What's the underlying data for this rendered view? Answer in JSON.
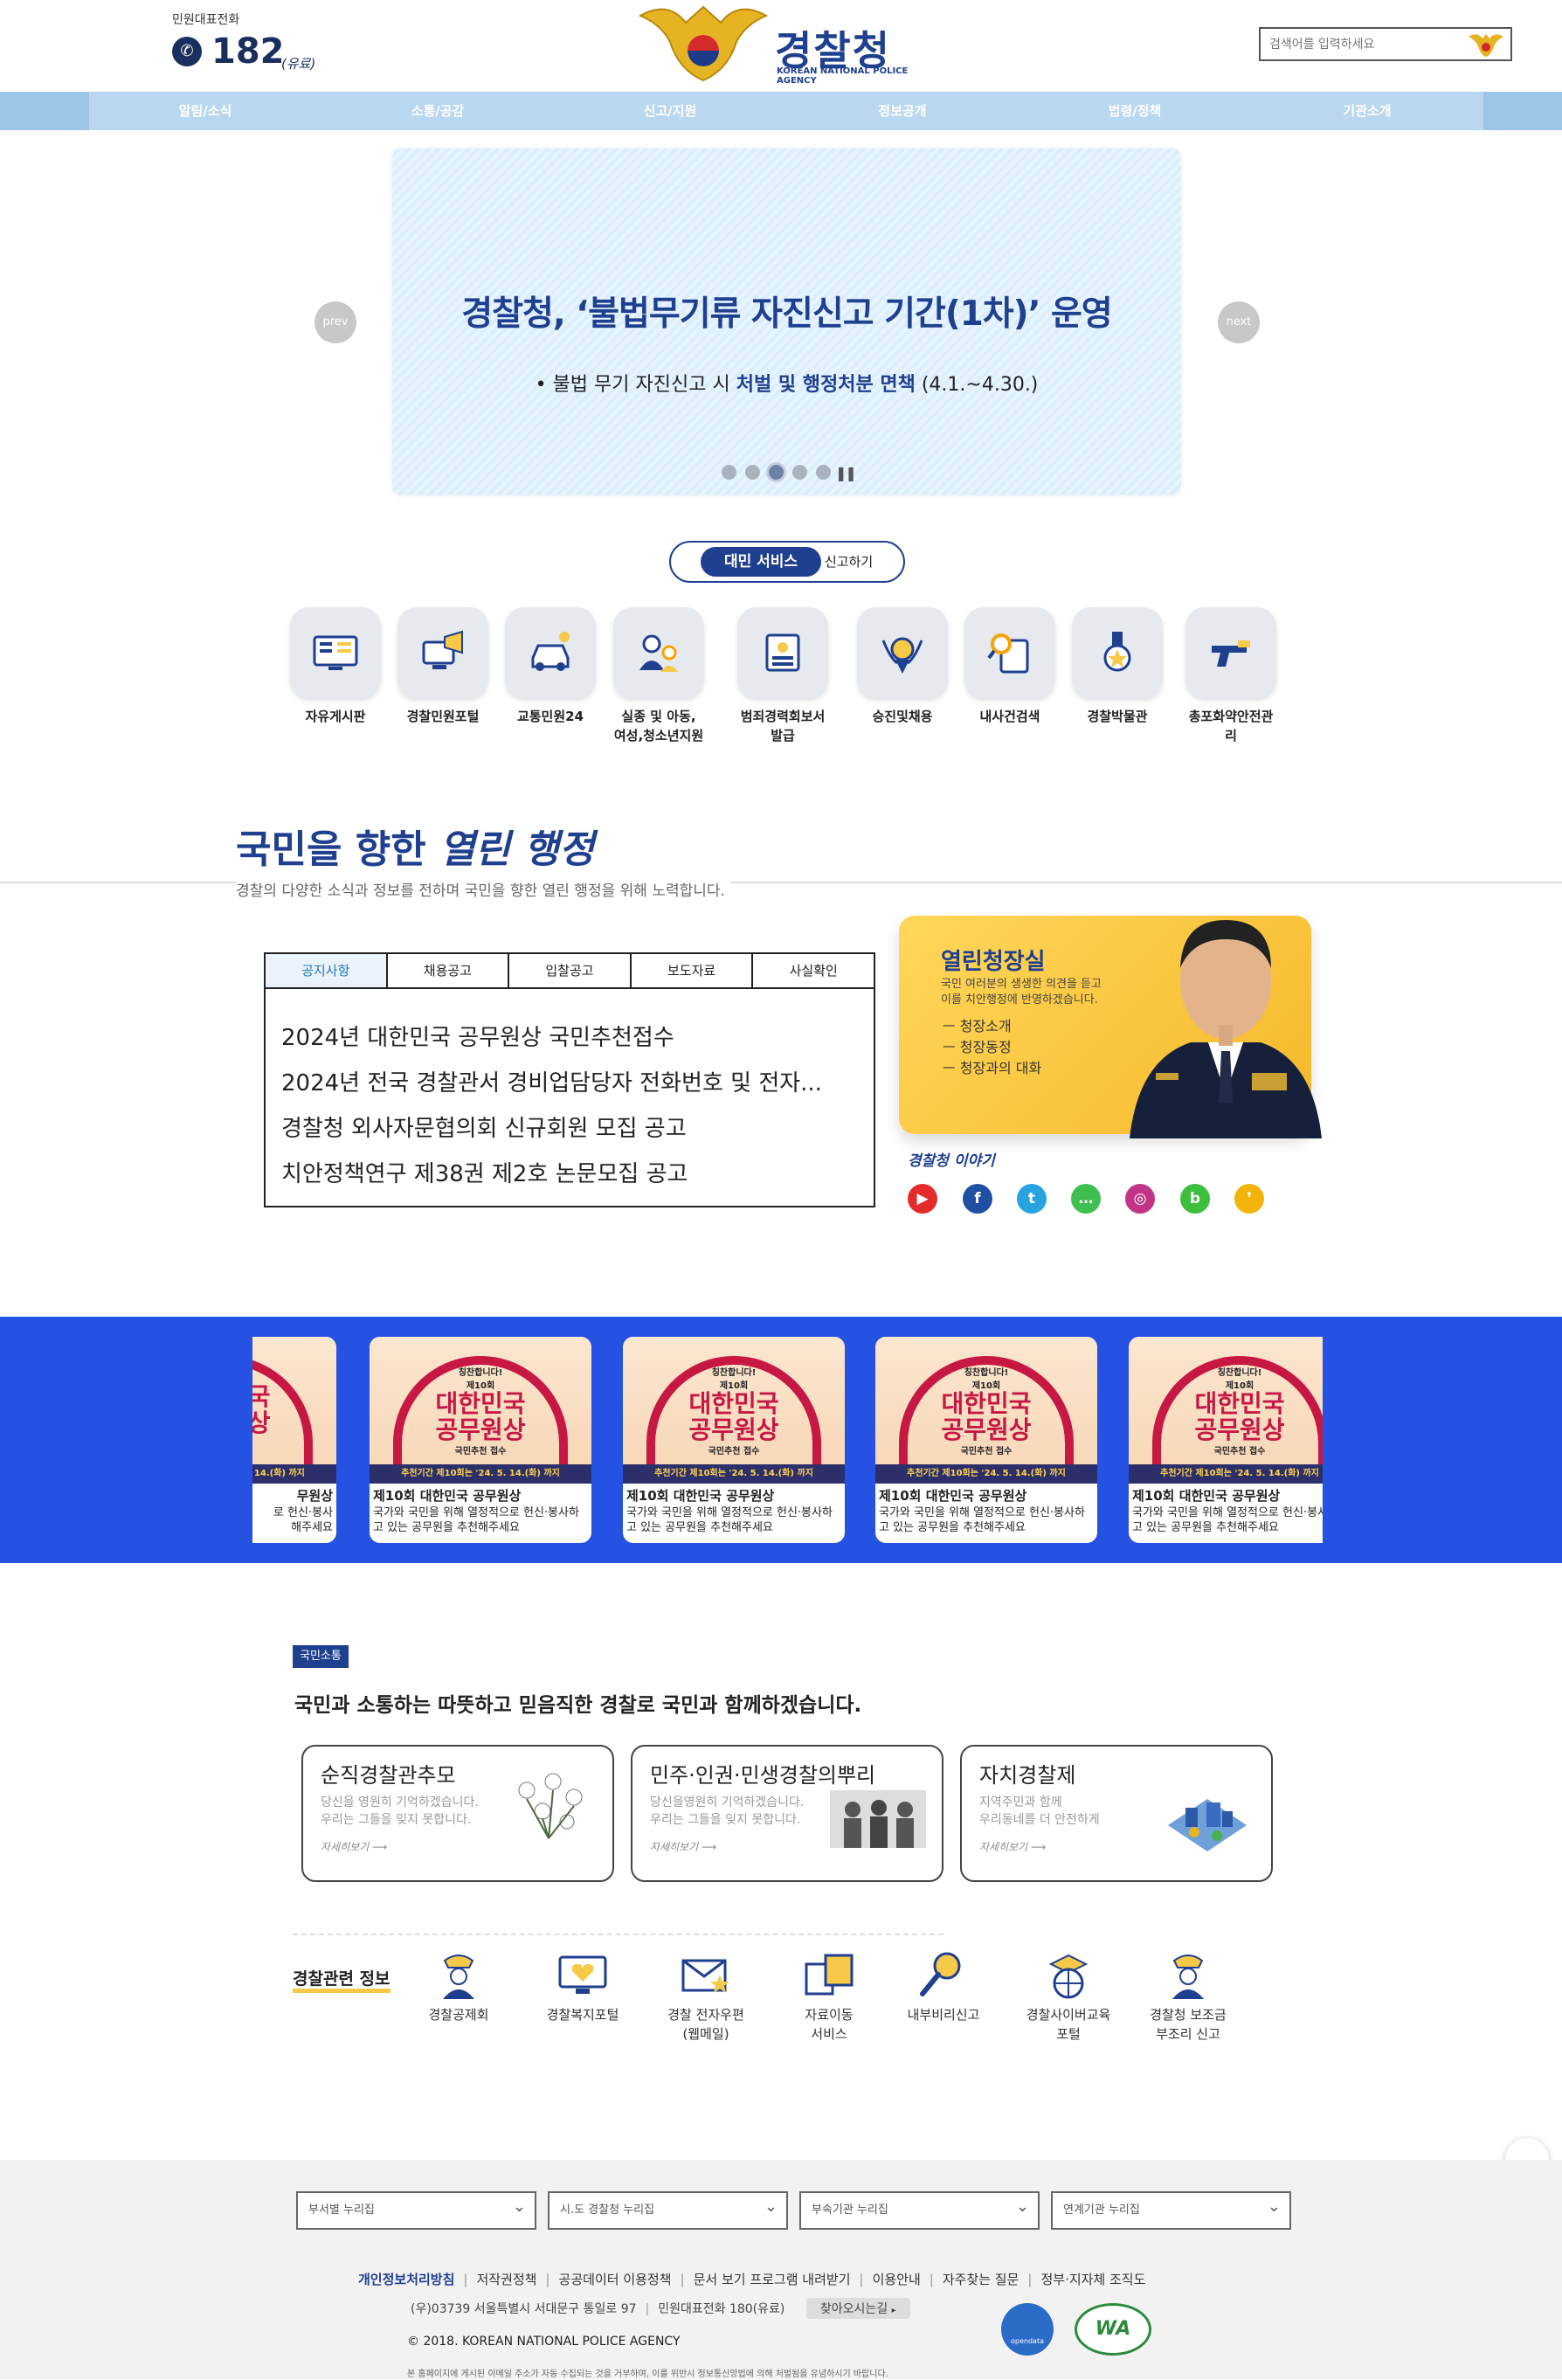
{
  "header": {
    "hotline_label": "민원대표전화",
    "hotline_number": "182",
    "hotline_note": "(유료)",
    "logo_kr": "경찰청",
    "logo_en": "KOREAN NATIONAL POLICE AGENCY",
    "search_placeholder": "검색어를 입력하세요"
  },
  "nav": [
    "알림/소식",
    "소통/공감",
    "신고/지원",
    "정보공개",
    "법령/정책",
    "기관소개"
  ],
  "banner": {
    "title": "경찰청, ‘불법무기류 자진신고 기간(1차)’ 운영",
    "sub_prefix": "• 불법 무기 자진신고 시 ",
    "sub_bold": "처벌 및 행정처분 면책",
    "sub_suffix": " (4.1.~4.30.)",
    "prev": "prev",
    "next": "next"
  },
  "service_toggle": {
    "active": "대민 서비스",
    "other": "신고하기"
  },
  "services": [
    {
      "label": "자유게시판",
      "icon": "board-icon"
    },
    {
      "label": "경찰민원포털",
      "icon": "complaint-portal-icon"
    },
    {
      "label": "교통민원24",
      "icon": "traffic-icon"
    },
    {
      "label": "실종 및 아동,\n여성,청소년지원",
      "icon": "missing-child-icon"
    },
    {
      "label": "범죄경력회보서발급",
      "icon": "criminal-record-icon"
    },
    {
      "label": "승진및채용",
      "icon": "promotion-icon"
    },
    {
      "label": "내사건검색",
      "icon": "case-search-icon"
    },
    {
      "label": "경찰박물관",
      "icon": "museum-icon"
    },
    {
      "label": "총포화약안전관리",
      "icon": "firearm-icon"
    }
  ],
  "open_admin": {
    "title_plain": "국민을 향한 ",
    "title_italic": "열린 행정",
    "subtitle": "경찰의 다양한 소식과 정보를 전하며 국민을 향한 열린 행정을 위해 노력합니다."
  },
  "notice_tabs": [
    "공지사항",
    "채용공고",
    "입찰공고",
    "보도자료",
    "사실확인"
  ],
  "notices": [
    "2024년 대한민국 공무원상 국민추천접수",
    "2024년 전국 경찰관서 경비업담당자 전화번호 및 전자...",
    "경찰청 외사자문협의회 신규회원 모집 공고",
    "치안정책연구 제38권 제2호 논문모집 공고"
  ],
  "commissioner": {
    "title": "열린청장실",
    "desc": "국민 여러분의 생생한 의견을 듣고\n이를 치안행정에 반영하겠습니다.",
    "links": [
      "ㅡ 청장소개",
      "ㅡ 청장동정",
      "ㅡ 청장과의 대화"
    ],
    "story_label": "경찰청 이야기"
  },
  "sns": [
    {
      "name": "youtube-icon",
      "color": "#e32b2b",
      "glyph": "▶"
    },
    {
      "name": "facebook-icon",
      "color": "#1f4fa3",
      "glyph": "f"
    },
    {
      "name": "twitter-icon",
      "color": "#27a3e0",
      "glyph": "t"
    },
    {
      "name": "talk-icon",
      "color": "#3fbf4f",
      "glyph": "…"
    },
    {
      "name": "instagram-icon",
      "color": "#c13584",
      "glyph": "◎"
    },
    {
      "name": "blog-icon",
      "color": "#3cbf3c",
      "glyph": "b"
    },
    {
      "name": "kakaostory-icon",
      "color": "#f2b40a",
      "glyph": "❜"
    }
  ],
  "cards": {
    "poster_top": "칭찬합니다!",
    "poster_edition": "제10회",
    "poster_title": "대한민국\n공무원상",
    "poster_sub": "국민추천 접수",
    "poster_foot": "추천기간 제10회는 '24. 5. 14.(화) 까지",
    "caption_title": "제10회 대한민국 공무원상",
    "caption_body": "국가와 국민을 위해 열정적으로 헌신·봉사하고 있는 공무원을 추천해주세요",
    "partial_title": "무원상",
    "partial_body": "로 헌신·봉사\n해주세요"
  },
  "communication": {
    "badge": "국민소통",
    "heading": "국민과 소통하는 따뜻하고 믿음직한 경찰로 국민과 함께하겠습니다.",
    "cards": [
      {
        "title": "순직경찰관추모",
        "desc": "당신을 영원히 기억하겠습니다.\n우리는 그들을 잊지 못합니다.",
        "more": "자세히보기 ⟶"
      },
      {
        "title": "민주·인권·민생경찰의뿌리",
        "desc": "당신을영원히 기억하겠습니다.\n우리는 그들을 잊지 못합니다.",
        "more": "자세히보기 ⟶"
      },
      {
        "title": "자치경찰제",
        "desc": "지역주민과 함께\n우리동네를 더 안전하게",
        "more": "자세히보기 ⟶"
      }
    ]
  },
  "related": {
    "label": "경찰관련 정보",
    "items": [
      {
        "label": "경찰공제회",
        "icon": "mutual-aid-icon"
      },
      {
        "label": "경찰복지포털",
        "icon": "welfare-portal-icon"
      },
      {
        "label": "경찰 전자우편\n(웹메일)",
        "icon": "webmail-icon"
      },
      {
        "label": "자료이동\n서비스",
        "icon": "data-transfer-icon"
      },
      {
        "label": "내부비리신고",
        "icon": "corruption-report-icon"
      },
      {
        "label": "경찰사이버교육\n포털",
        "icon": "cyber-education-icon"
      },
      {
        "label": "경찰청 보조금\n부조리 신고",
        "icon": "subsidy-report-icon"
      }
    ]
  },
  "footer": {
    "selects": [
      "부서별 누리집",
      "시.도 경찰청 누리집",
      "부속기관 누리집",
      "연계기관 누리집"
    ],
    "links": [
      "개인정보처리방침",
      "저작권정책",
      "공공데이터 이용정책",
      "문서 보기 프로그램 내려받기",
      "이용안내",
      "자주찾는 질문",
      "정부·지자체 조직도"
    ],
    "address": "(우)03739 서울특별시 서대문구 통일로 97",
    "hotline": "민원대표전화 180(유료)",
    "directions": "찾아오시는길",
    "copyright": "© 2018. KOREAN NATIONAL POLICE AGENCY",
    "notice": "본 홈페이지에 게시된 이메일 주소가 자동 수집되는 것을 거부하며, 이를 위반시 정보통신망법에 의해 처벌됨을 유념하시기 바랍니다.",
    "badge1": "opendata",
    "badge2": "WA"
  },
  "colors": {
    "primary": "#1f3f8f",
    "band": "#2552e2",
    "nav": "#b9d8ef",
    "accent": "#f7c948"
  }
}
